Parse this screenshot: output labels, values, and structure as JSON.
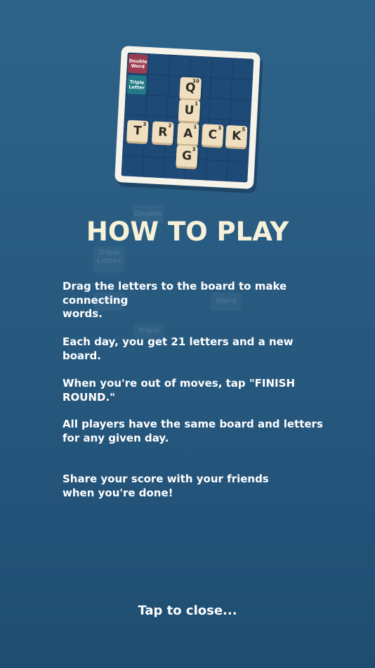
{
  "header": {
    "title": "HOW TO PLAY"
  },
  "board_preview": {
    "bonus_labels": [
      "Double\nWord",
      "Triple\nLetter"
    ],
    "tiles": [
      {
        "letter": "Q",
        "points": "10"
      },
      {
        "letter": "U",
        "points": "1"
      },
      {
        "letter": "T",
        "points": "3"
      },
      {
        "letter": "R",
        "points": "2"
      },
      {
        "letter": "A",
        "points": "1"
      },
      {
        "letter": "C",
        "points": "3"
      },
      {
        "letter": "K",
        "points": "5"
      },
      {
        "letter": "G",
        "points": "3"
      }
    ]
  },
  "background_tiles": [
    "Double",
    "Triple\nLetter",
    "Word",
    "Word",
    "Triple"
  ],
  "instructions": [
    "Drag the letters to the board to make connecting\nwords.",
    "Each day, you get 21 letters and a new board.",
    "When you're out of moves, tap \"FINISH ROUND.\"",
    "All players have the same board and letters\nfor any given day.",
    "Share your score with your friends\nwhen you're done!"
  ],
  "footer": {
    "close_label": "Tap to close..."
  },
  "colors": {
    "background": "#2a5c84",
    "title": "#f7f1da",
    "double_word": "#9c3b4f",
    "triple_letter": "#217a86",
    "tile": "#f0dfbe"
  }
}
